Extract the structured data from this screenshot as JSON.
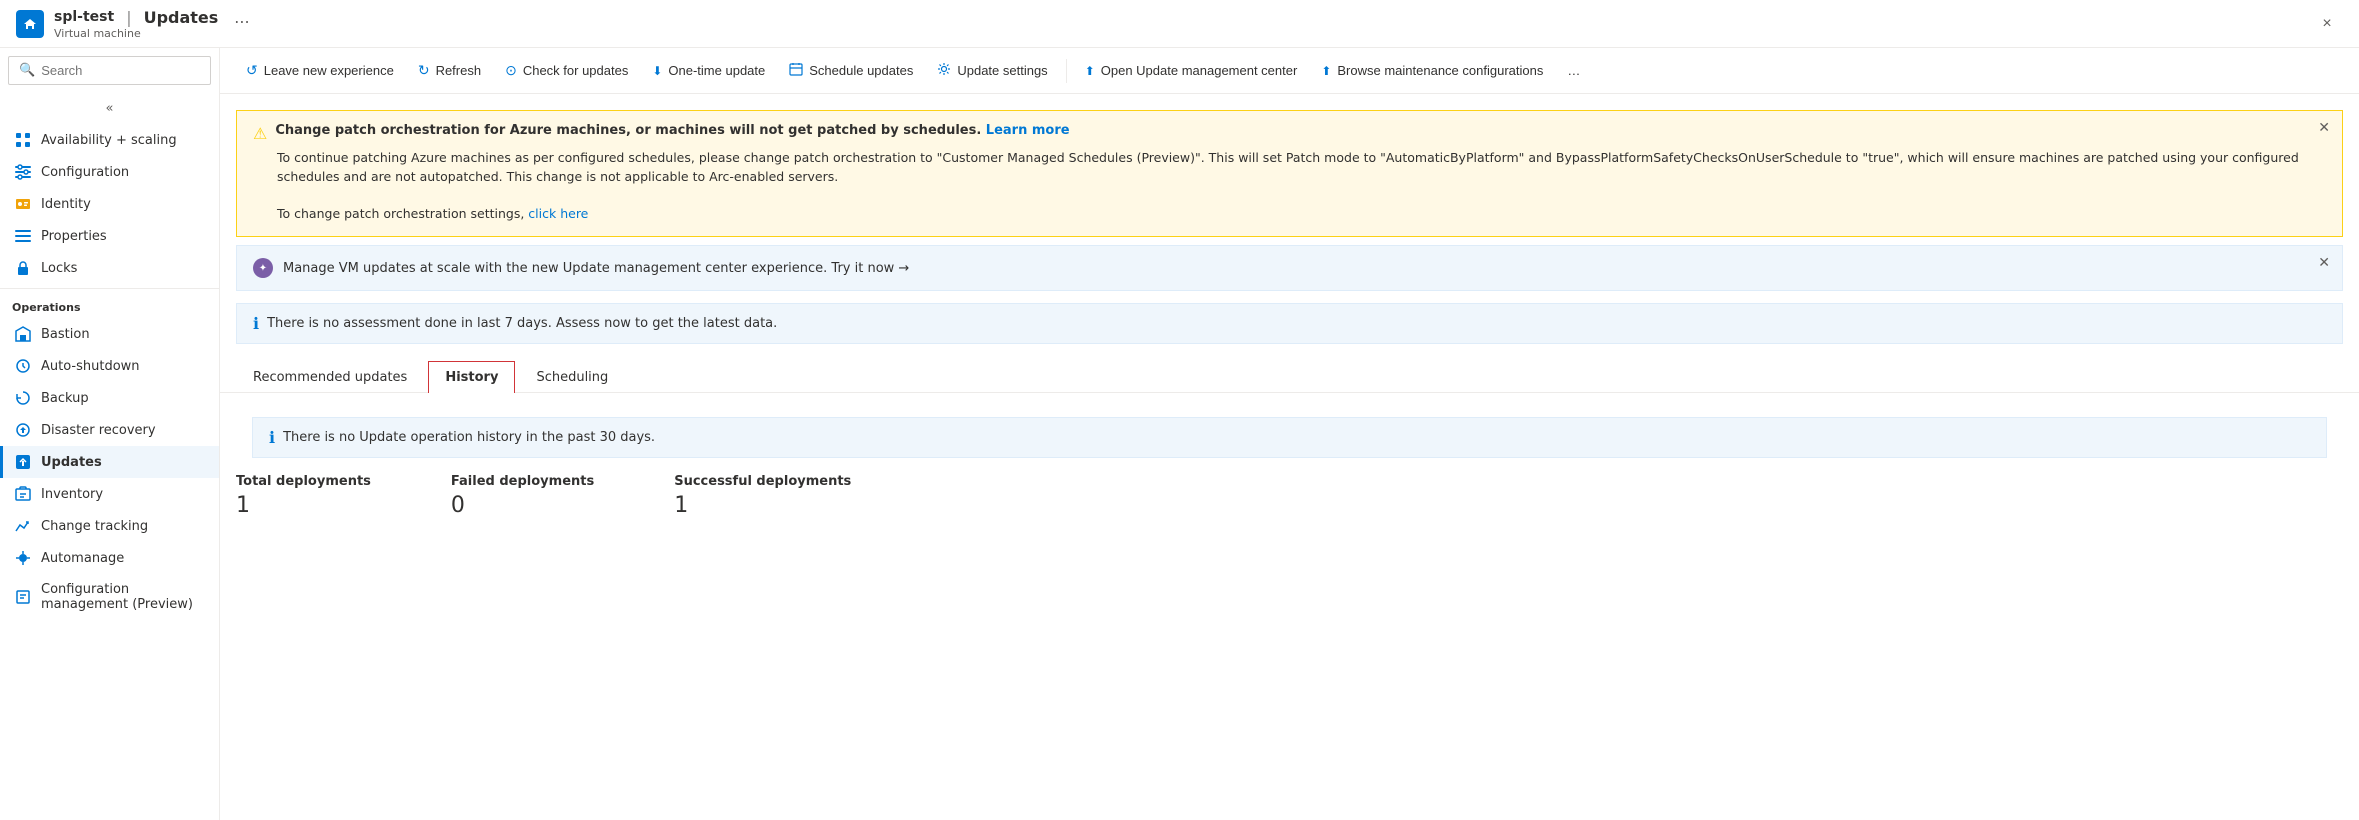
{
  "header": {
    "app_icon": "S",
    "resource_name": "spl-test",
    "separator": "|",
    "page_title": "Updates",
    "ellipsis": "...",
    "resource_type": "Virtual machine",
    "close_label": "×"
  },
  "sidebar": {
    "search_placeholder": "Search",
    "collapse_icon": "«",
    "items_top": [
      {
        "id": "availability",
        "label": "Availability + scaling",
        "icon": "grid"
      },
      {
        "id": "configuration",
        "label": "Configuration",
        "icon": "sliders"
      },
      {
        "id": "identity",
        "label": "Identity",
        "icon": "id"
      },
      {
        "id": "properties",
        "label": "Properties",
        "icon": "list"
      },
      {
        "id": "locks",
        "label": "Locks",
        "icon": "lock"
      }
    ],
    "section_operations": "Operations",
    "items_operations": [
      {
        "id": "bastion",
        "label": "Bastion",
        "icon": "bastion"
      },
      {
        "id": "autoshutdown",
        "label": "Auto-shutdown",
        "icon": "clock"
      },
      {
        "id": "backup",
        "label": "Backup",
        "icon": "backup"
      },
      {
        "id": "disaster-recovery",
        "label": "Disaster recovery",
        "icon": "dr"
      },
      {
        "id": "updates",
        "label": "Updates",
        "icon": "updates",
        "active": true
      },
      {
        "id": "inventory",
        "label": "Inventory",
        "icon": "inventory"
      },
      {
        "id": "change-tracking",
        "label": "Change tracking",
        "icon": "ct"
      },
      {
        "id": "automanage",
        "label": "Automanage",
        "icon": "automanage"
      },
      {
        "id": "config-mgmt",
        "label": "Configuration management\n(Preview)",
        "icon": "cm"
      }
    ]
  },
  "toolbar": {
    "buttons": [
      {
        "id": "leave-new-exp",
        "icon": "↺",
        "label": "Leave new experience"
      },
      {
        "id": "refresh",
        "icon": "↻",
        "label": "Refresh"
      },
      {
        "id": "check-updates",
        "icon": "⊙",
        "label": "Check for updates"
      },
      {
        "id": "one-time-update",
        "icon": "⬇",
        "label": "One-time update"
      },
      {
        "id": "schedule-updates",
        "icon": "📅",
        "label": "Schedule updates"
      },
      {
        "id": "update-settings",
        "icon": "⚙",
        "label": "Update settings"
      },
      {
        "id": "open-umc",
        "icon": "⬆",
        "label": "Open Update management center"
      },
      {
        "id": "browse-maintenance",
        "icon": "⬆",
        "label": "Browse maintenance configurations"
      },
      {
        "id": "more",
        "icon": "…",
        "label": "..."
      }
    ]
  },
  "alerts": {
    "warning": {
      "title": "Change patch orchestration for Azure machines, or machines will not get patched by schedules.",
      "title_link": "Learn more",
      "body": "To continue patching Azure machines as per configured schedules, please change patch orchestration to \"Customer Managed Schedules (Preview)\". This will set Patch mode to \"AutomaticByPlatform\" and BypassPlatformSafetyChecksOnUserSchedule to \"true\", which will ensure machines are patched using your configured schedules and are not autopatched. This change is not applicable to Arc-enabled servers.",
      "body2": "To change patch orchestration settings, ",
      "link_text": "click here"
    },
    "promo": {
      "text": "Manage VM updates at scale with the new Update management center experience. Try it now →"
    },
    "assessment": {
      "text": "There is no assessment done in last 7 days. Assess now to get the latest data."
    }
  },
  "tabs": [
    {
      "id": "recommended",
      "label": "Recommended updates"
    },
    {
      "id": "history",
      "label": "History",
      "active": true
    },
    {
      "id": "scheduling",
      "label": "Scheduling"
    }
  ],
  "history": {
    "no_history_text": "There is no Update operation history in the past 30 days.",
    "stats": [
      {
        "label": "Total deployments",
        "value": "1"
      },
      {
        "label": "Failed deployments",
        "value": "0"
      },
      {
        "label": "Successful deployments",
        "value": "1"
      }
    ]
  }
}
